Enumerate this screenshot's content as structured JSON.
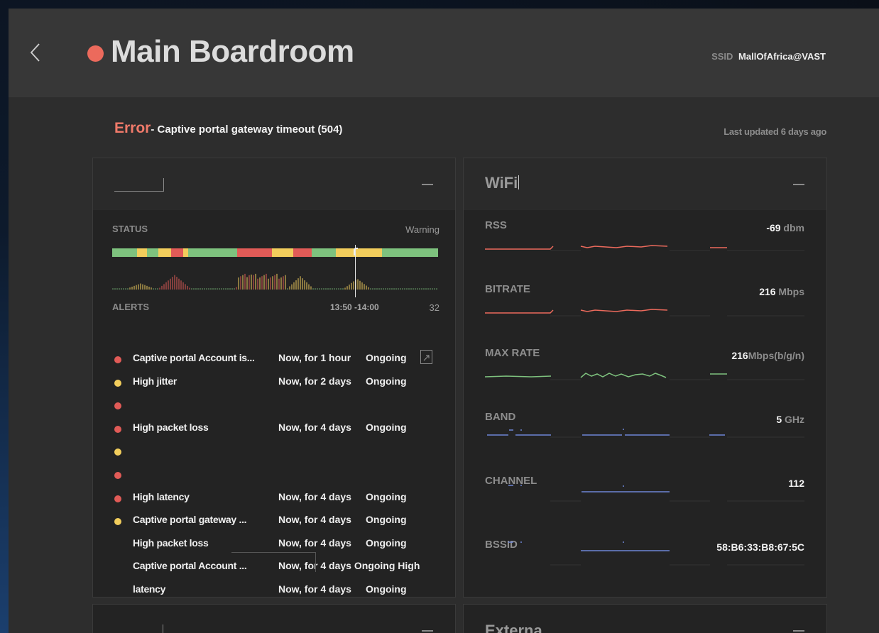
{
  "header": {
    "title": "Main Boardroom",
    "status_color": "#ec6a5c",
    "ssid_label": "SSID",
    "ssid_value": "MallOfAfrica@VAST"
  },
  "error": {
    "label": "Error",
    "message": "- Captive portal gateway timeout (504)",
    "last_updated": "Last updated 6 days ago"
  },
  "status_card": {
    "status_label": "STATUS",
    "status_value": "Warning",
    "alerts_label": "ALERTS",
    "alerts_range": "13:50 -14:00",
    "alerts_count": "32",
    "colors": {
      "ok": "#7ec27e",
      "warn": "#f2cd5c",
      "error": "#e15b57"
    },
    "status_segments": [
      {
        "state": "ok",
        "share": 7.5
      },
      {
        "state": "warn",
        "share": 3
      },
      {
        "state": "ok",
        "share": 3.5
      },
      {
        "state": "warn",
        "share": 4
      },
      {
        "state": "error",
        "share": 3.5
      },
      {
        "state": "warn",
        "share": 1.5
      },
      {
        "state": "ok",
        "share": 15
      },
      {
        "state": "error",
        "share": 10.5
      },
      {
        "state": "warn",
        "share": 6.5
      },
      {
        "state": "error",
        "share": 5.5
      },
      {
        "state": "ok",
        "share": 7.5
      },
      {
        "state": "warn",
        "share": 14
      },
      {
        "state": "ok",
        "share": 17
      }
    ],
    "alerts": [
      {
        "severity": "error",
        "name": "Captive portal Account is...",
        "time": "Now, for 1 hour",
        "state": "Ongoing",
        "link_icon": "external-link-icon"
      },
      {
        "severity": "warn",
        "name": "High jitter",
        "time": "Now, for 2 days",
        "state": "Ongoing"
      },
      {
        "severity": "error",
        "name": "",
        "time": "",
        "state": ""
      },
      {
        "severity": "error",
        "name": "High packet loss",
        "time": "Now, for 4 days",
        "state": "Ongoing"
      },
      {
        "severity": "warn",
        "name": "",
        "time": "",
        "state": ""
      },
      {
        "severity": "error",
        "name": "",
        "time": "",
        "state": ""
      },
      {
        "severity": "error",
        "name": "High latency",
        "time": "Now, for 4 days",
        "state": "Ongoing"
      },
      {
        "severity": "warn",
        "name": "Captive portal gateway ...",
        "time": "Now, for 4 days",
        "state": "Ongoing"
      },
      {
        "severity": "",
        "name": "High packet loss",
        "time": "Now, for 4 days",
        "state": "Ongoing"
      },
      {
        "severity": "",
        "name": "Captive portal Account ...",
        "time": "Now, for 4 days Ongoing High",
        "state": ""
      },
      {
        "severity": "",
        "name": "latency",
        "time": "Now, for 4 days",
        "state": "Ongoing"
      }
    ]
  },
  "wifi_card": {
    "title": "WiFi",
    "metrics": [
      {
        "label": "RSS",
        "value": "-69",
        "unit": "dbm",
        "color": "#ec6a5c"
      },
      {
        "label": "BITRATE",
        "value": "216",
        "unit": "Mbps",
        "color": "#ec6a5c"
      },
      {
        "label": "MAX RATE",
        "value": "216",
        "unit": "Mbps(b/g/n)",
        "color": "#7ec27e"
      },
      {
        "label": "BAND",
        "value": "5",
        "unit": "GHz",
        "color": "#6e86d6"
      },
      {
        "label": "CHANNEL",
        "value": "112",
        "unit": "",
        "color": "#6e86d6"
      },
      {
        "label": "BSSID",
        "value": "58:B6:33:B8:67:5C",
        "unit": "",
        "color": "#6e86d6"
      }
    ]
  },
  "bottom_cards": {
    "right_title": "Externa"
  }
}
